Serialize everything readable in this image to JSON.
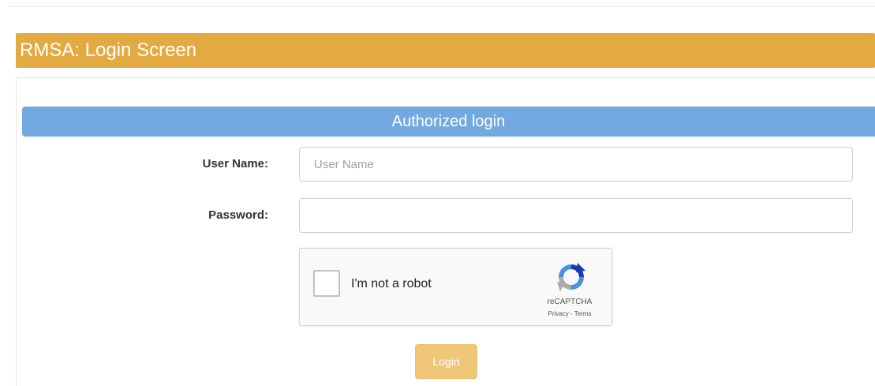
{
  "panel": {
    "title": "RMSA: Login Screen"
  },
  "form": {
    "heading": "Authorized login",
    "username": {
      "label": "User Name:",
      "placeholder": "User Name",
      "value": ""
    },
    "password": {
      "label": "Password:",
      "placeholder": "",
      "value": ""
    },
    "login_label": "Login"
  },
  "captcha": {
    "label": "I'm not a robot",
    "brand": "reCAPTCHA",
    "privacy": "Privacy",
    "separator": " - ",
    "terms": "Terms",
    "checked": false
  },
  "colors": {
    "panel_heading": "#e3aa42",
    "form_heading": "#72a9e0",
    "login_button": "#f0c779"
  },
  "icons": {
    "captcha_logo": "recaptcha-icon"
  }
}
